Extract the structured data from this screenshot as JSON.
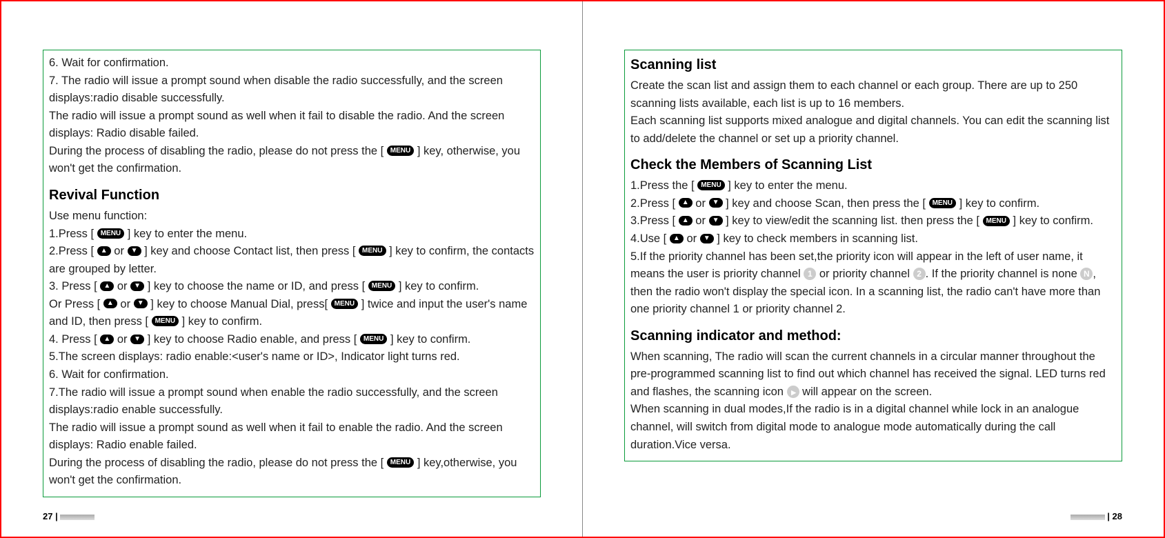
{
  "left": {
    "pageNum": "27",
    "l1": "6. Wait for confirmation.",
    "l2": "7. The radio will issue a prompt sound when disable the radio successfully, and the screen displays:radio disable successfully.",
    "l3": "The radio will issue a prompt sound as well when it fail to disable the radio. And the screen displays: Radio disable failed.",
    "l4a": "During the process of disabling the radio, please do not press the [ ",
    "l4b": " ] key, otherwise, you won't get the confirmation.",
    "h1": "Revival Function",
    "l5": "Use menu function:",
    "l6a": "1.Press [ ",
    "l6b": " ] key to enter the menu.",
    "l7a": "2.Press [ ",
    "l7b": " or ",
    "l7c": " ] key and choose Contact list, then press [ ",
    "l7d": " ] key to confirm, the contacts are grouped by letter.",
    "l8a": "3. Press [ ",
    "l8b": " or ",
    "l8c": " ] key to choose the name or ID, and press [ ",
    "l8d": " ] key to confirm.",
    "l9a": "Or Press [ ",
    "l9b": " or ",
    "l9c": " ] key to choose Manual Dial, press[ ",
    "l9d": " ] twice and input the user's name and ID, then press [ ",
    "l9e": " ] key to confirm.",
    "l10a": "4. Press [ ",
    "l10b": " or ",
    "l10c": " ] key to choose Radio enable, and press [ ",
    "l10d": " ] key to confirm.",
    "l11": "5.The screen displays: radio enable:<user's name or ID>, Indicator light turns red.",
    "l12": "6. Wait for confirmation.",
    "l13": "7.The radio will issue a prompt sound when enable the radio successfully, and the screen displays:radio enable successfully.",
    "l14": "The radio will issue a prompt sound as well when it fail to enable the radio. And the screen displays: Radio enable failed.",
    "l15a": "During the process of disabling the radio, please do not press the [ ",
    "l15b": " ] key,otherwise, you won't get the confirmation."
  },
  "right": {
    "pageNum": "28",
    "h1": "Scanning list",
    "r1": "Create the scan list and assign them to each channel or each group. There are up to 250 scanning lists available, each list is up to 16 members.",
    "r2": "Each scanning list supports mixed analogue and digital channels. You can edit the scanning list to add/delete the channel or set up a priority channel.",
    "h2": "Check the Members of Scanning List",
    "r3a": "1.Press the [ ",
    "r3b": " ] key to enter the menu.",
    "r4a": "2.Press [ ",
    "r4b": " or ",
    "r4c": " ] key and choose Scan, then press the [ ",
    "r4d": " ] key to confirm.",
    "r5a": "3.Press [ ",
    "r5b": " or ",
    "r5c": " ] key to view/edit the scanning list. then press the [ ",
    "r5d": " ] key to confirm.",
    "r6a": "4.Use [ ",
    "r6b": " or ",
    "r6c": " ] key to check members in scanning list.",
    "r7a": "5.If the priority channel has been set,the priority icon will appear in the left of user name, it means the user is priority channel ",
    "r7b": " or priority channel ",
    "r7c": ". If the priority channel is none ",
    "r7d": ", then the radio won't display the special icon. In a scanning list, the radio can't have more than one priority channel 1 or priority channel 2.",
    "h3": "Scanning indicator and method:",
    "r8a": "When scanning, The radio will scan the current channels in a circular manner throughout the pre-programmed scanning list to find out which channel has received the signal. LED turns red and flashes, the scanning icon ",
    "r8b": " will appear on the screen.",
    "r9": "When scanning in dual modes,If the radio is in a digital channel while lock in an analogue channel, will switch from digital mode to analogue mode automatically during the call duration.Vice versa.",
    "c1": "1",
    "c2": "2",
    "cN": "N"
  }
}
